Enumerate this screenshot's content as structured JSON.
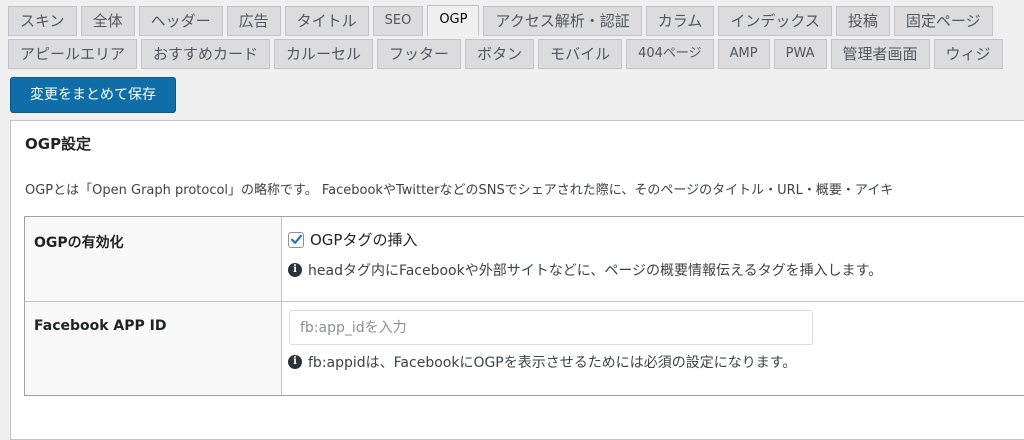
{
  "tabs_row1": [
    "スキン",
    "全体",
    "ヘッダー",
    "広告",
    "タイトル",
    "SEO",
    "OGP",
    "アクセス解析・認証",
    "カラム",
    "インデックス",
    "投稿",
    "固定ページ"
  ],
  "tabs_row2": [
    "アピールエリア",
    "おすすめカード",
    "カルーセル",
    "フッター",
    "ボタン",
    "モバイル",
    "404ページ",
    "AMP",
    "PWA",
    "管理者画面",
    "ウィジ"
  ],
  "active_tab": "OGP",
  "save_button": "変更をまとめて保存",
  "panel": {
    "title": "OGP設定",
    "description": "OGPとは「Open Graph protocol」の略称です。 FacebookやTwitterなどのSNSでシェアされた際に、そのページのタイトル・URL・概要・アイキ"
  },
  "settings": {
    "ogp_enable": {
      "label": "OGPの有効化",
      "checkbox_label": "OGPタグの挿入",
      "checked": true,
      "note": "headタグ内にFacebookや外部サイトなどに、ページの概要情報伝えるタグを挿入します。"
    },
    "facebook_app_id": {
      "label": "Facebook APP ID",
      "value": "",
      "placeholder": "fb:app_idを入力",
      "note": "fb:appidは、FacebookにOGPを表示させるためには必須の設定になります。"
    }
  },
  "icons": {
    "info": "info-circle-icon",
    "check": "checkmark-icon"
  },
  "colors": {
    "primary_button": "#0f6ea7",
    "check": "#2271b1"
  }
}
